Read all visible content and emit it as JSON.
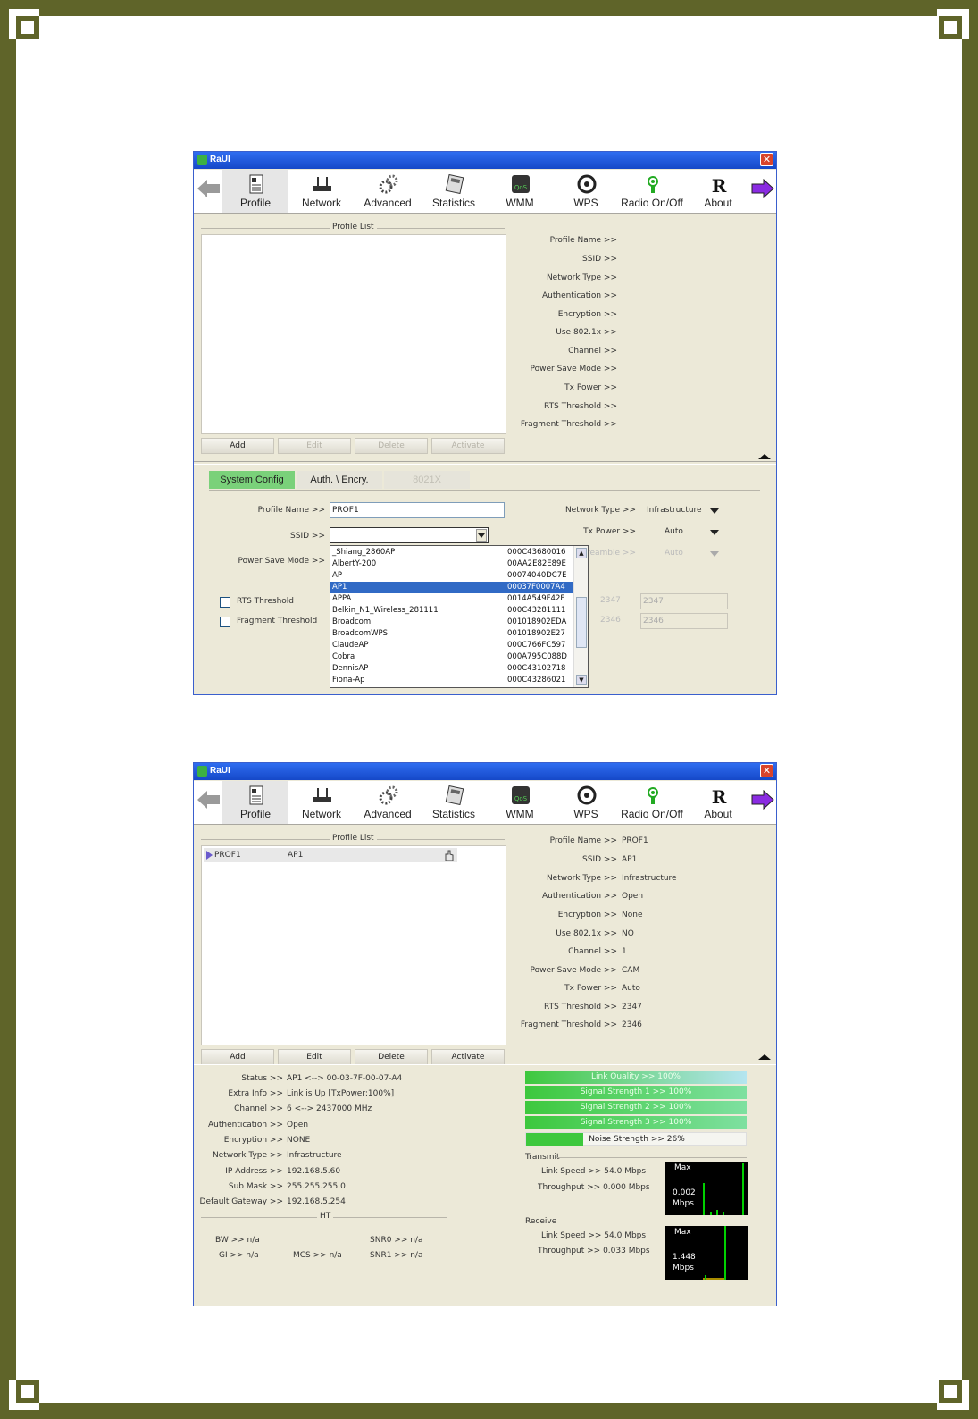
{
  "window1": {
    "title": "RaUI",
    "toolbar": [
      "Profile",
      "Network",
      "Advanced",
      "Statistics",
      "WMM",
      "WPS",
      "Radio On/Off",
      "About"
    ],
    "profile_list_title": "Profile List",
    "buttons": {
      "add": "Add",
      "edit": "Edit",
      "delete": "Delete",
      "activate": "Activate"
    },
    "details_labels": [
      "Profile Name >>",
      "SSID >>",
      "Network Type >>",
      "Authentication >>",
      "Encryption >>",
      "Use 802.1x >>",
      "Channel >>",
      "Power Save Mode >>",
      "Tx Power >>",
      "RTS Threshold >>",
      "Fragment Threshold >>"
    ],
    "tabs": {
      "system": "System Config",
      "auth": "Auth. \\ Encry.",
      "8021x": "8021X"
    },
    "form": {
      "profile_name_label": "Profile Name >>",
      "profile_name_value": "PROF1",
      "ssid_label": "SSID >>",
      "ssid_value": "",
      "power_save_label": "Power Save Mode >>",
      "rts_label": "RTS Threshold",
      "frag_label": "Fragment Threshold",
      "network_type_label": "Network Type >>",
      "network_type_value": "Infrastructure",
      "tx_power_label": "Tx Power >>",
      "tx_power_value": "Auto",
      "preamble_label": "Preamble >>",
      "preamble_value": "Auto",
      "rts_slider_val": "2347",
      "rts_field": "2347",
      "frag_slider_val": "2346",
      "frag_field": "2346"
    },
    "ssid_dropdown": [
      {
        "name": "_Shiang_2860AP",
        "mac": "000C43680016"
      },
      {
        "name": "AlbertY-200",
        "mac": "00AA2E82E89E"
      },
      {
        "name": "AP",
        "mac": "00074040DC7E"
      },
      {
        "name": "AP1",
        "mac": "00037F0007A4"
      },
      {
        "name": "APPA",
        "mac": "0014A549F42F"
      },
      {
        "name": "Belkin_N1_Wireless_281111",
        "mac": "000C43281111"
      },
      {
        "name": "Broadcom",
        "mac": "001018902EDA"
      },
      {
        "name": "BroadcomWPS",
        "mac": "001018902E27"
      },
      {
        "name": "ClaudeAP",
        "mac": "000C766FC597"
      },
      {
        "name": "Cobra",
        "mac": "000A795C088D"
      },
      {
        "name": "DennisAP",
        "mac": "000C43102718"
      },
      {
        "name": "Fiona-Ap",
        "mac": "000C43286021"
      }
    ]
  },
  "window2": {
    "title": "RaUI",
    "toolbar": [
      "Profile",
      "Network",
      "Advanced",
      "Statistics",
      "WMM",
      "WPS",
      "Radio On/Off",
      "About"
    ],
    "profile_list_title": "Profile List",
    "profile_row": {
      "name": "PROF1",
      "ssid": "AP1"
    },
    "buttons": {
      "add": "Add",
      "edit": "Edit",
      "delete": "Delete",
      "activate": "Activate"
    },
    "details": [
      {
        "label": "Profile Name >>",
        "value": "PROF1"
      },
      {
        "label": "SSID >>",
        "value": "AP1"
      },
      {
        "label": "Network Type >>",
        "value": "Infrastructure"
      },
      {
        "label": "Authentication >>",
        "value": "Open"
      },
      {
        "label": "Encryption >>",
        "value": "None"
      },
      {
        "label": "Use 802.1x >>",
        "value": "NO"
      },
      {
        "label": "Channel >>",
        "value": "1"
      },
      {
        "label": "Power Save Mode >>",
        "value": "CAM"
      },
      {
        "label": "Tx Power >>",
        "value": "Auto"
      },
      {
        "label": "RTS Threshold >>",
        "value": "2347"
      },
      {
        "label": "Fragment Threshold >>",
        "value": "2346"
      }
    ],
    "status": [
      {
        "label": "Status >>",
        "value": "AP1 <--> 00-03-7F-00-07-A4"
      },
      {
        "label": "Extra Info >>",
        "value": "Link is Up [TxPower:100%]"
      },
      {
        "label": "Channel >>",
        "value": "6 <--> 2437000 MHz"
      },
      {
        "label": "Authentication >>",
        "value": "Open"
      },
      {
        "label": "Encryption >>",
        "value": "NONE"
      },
      {
        "label": "Network Type >>",
        "value": "Infrastructure"
      },
      {
        "label": "IP Address >>",
        "value": "192.168.5.60"
      },
      {
        "label": "Sub Mask >>",
        "value": "255.255.255.0"
      },
      {
        "label": "Default Gateway >>",
        "value": "192.168.5.254"
      }
    ],
    "ht": {
      "title": "HT",
      "bw": "BW >> n/a",
      "gi": "GI >> n/a",
      "mcs": "MCS >> n/a",
      "snr0": "SNR0 >> n/a",
      "snr1": "SNR1 >> n/a"
    },
    "signals": [
      {
        "text": "Link Quality >> 100%",
        "level": 1.0
      },
      {
        "text": "Signal Strength 1 >> 100%",
        "level": 1.0
      },
      {
        "text": "Signal Strength 2 >> 100%",
        "level": 1.0
      },
      {
        "text": "Signal Strength 3 >> 100%",
        "level": 1.0
      },
      {
        "text": "Noise Strength >> 26%",
        "level": 0.26
      }
    ],
    "transmit": {
      "title": "Transmit",
      "link_speed": "Link Speed >> 54.0 Mbps",
      "throughput": "Throughput >> 0.000 Mbps",
      "max": "Max",
      "value": "0.002",
      "unit": "Mbps"
    },
    "receive": {
      "title": "Receive",
      "link_speed": "Link Speed >> 54.0 Mbps",
      "throughput": "Throughput >> 0.033 Mbps",
      "max": "Max",
      "value": "1.448",
      "unit": "Mbps"
    }
  }
}
